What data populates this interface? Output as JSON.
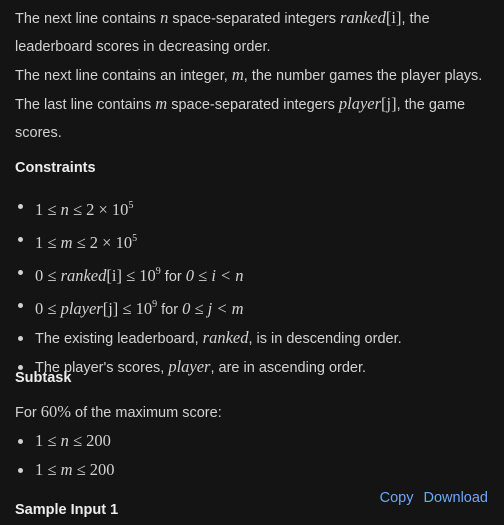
{
  "input_format": {
    "line1_prefix": "The next line contains ",
    "line1_var_n": "n",
    "line1_mid": " space-separated integers ",
    "line1_var_ranked": "ranked",
    "line1_idx": "[i]",
    "line1_suffix": ", the",
    "line2": "leaderboard scores in decreasing order.",
    "line3_prefix": "The next line contains an integer, ",
    "line3_var_m": "m",
    "line3_suffix": ", the number games the player plays.",
    "line4_prefix": "The last line contains ",
    "line4_var_m": "m",
    "line4_mid": " space-separated integers ",
    "line4_var_player": "player",
    "line4_idx": "[j]",
    "line4_suffix": ", the game",
    "line5": "scores."
  },
  "constraints": {
    "heading": "Constraints",
    "items": [
      {
        "lhs": "1 ≤ ",
        "var": "n",
        "rhs": " ≤ 2 × 10",
        "exp": "5"
      },
      {
        "lhs": "1 ≤ ",
        "var": "m",
        "rhs": " ≤ 2 × 10",
        "exp": "5"
      },
      {
        "lhs": "0 ≤ ",
        "var": "ranked",
        "idx": "[i]",
        "rhs": " ≤ 10",
        "exp": "9",
        "for_text": " for ",
        "cond": "0 ≤ i < n"
      },
      {
        "lhs": "0 ≤ ",
        "var": "player",
        "idx": "[j]",
        "rhs": " ≤ 10",
        "exp": "9",
        "for_text": " for ",
        "cond": "0 ≤ j < m"
      }
    ],
    "note1_prefix": "The existing leaderboard, ",
    "note1_var": "ranked",
    "note1_suffix": ", is in descending order.",
    "note2_prefix": "The player's scores, ",
    "note2_var": "player",
    "note2_suffix": ", are in ascending order."
  },
  "subtask": {
    "heading": "Subtask",
    "intro_prefix": "For ",
    "intro_pct": "60%",
    "intro_suffix": " of the maximum score:",
    "items": [
      {
        "lhs": "1 ≤ ",
        "var": "n",
        "rhs": " ≤ 200"
      },
      {
        "lhs": "1 ≤ ",
        "var": "m",
        "rhs": " ≤ 200"
      }
    ]
  },
  "sample": {
    "heading": "Sample Input 1",
    "copy_label": "Copy",
    "download_label": "Download"
  },
  "colors": {
    "background": "#141414",
    "text": "#d2d2d2",
    "link": "#6ea8f7"
  }
}
